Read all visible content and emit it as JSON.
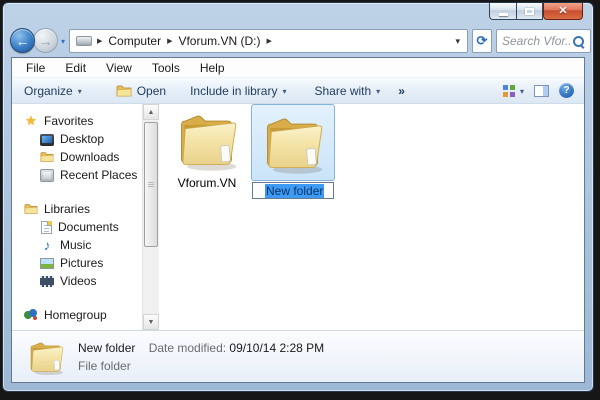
{
  "titlebar": {
    "close_icon": "✕"
  },
  "navbar": {
    "back_icon": "←",
    "forward_icon": "→",
    "history_dropdown_icon": "▾",
    "breadcrumb": {
      "separator": "▶",
      "items": [
        "Computer",
        "Vforum.VN (D:)"
      ]
    },
    "address_dropdown_icon": "▾",
    "refresh_icon": "⟳",
    "search": {
      "placeholder": "Search Vfor..."
    }
  },
  "menubar": {
    "items": [
      "File",
      "Edit",
      "View",
      "Tools",
      "Help"
    ]
  },
  "toolbar": {
    "organize_label": "Organize",
    "open_label": "Open",
    "include_label": "Include in library",
    "share_label": "Share with",
    "more_label": "»",
    "caret": "▾",
    "help_glyph": "?"
  },
  "sidebar": {
    "sections": [
      {
        "label": "Favorites",
        "children": [
          {
            "label": "Desktop"
          },
          {
            "label": "Downloads"
          },
          {
            "label": "Recent Places"
          }
        ]
      },
      {
        "label": "Libraries",
        "children": [
          {
            "label": "Documents"
          },
          {
            "label": "Music"
          },
          {
            "label": "Pictures"
          },
          {
            "label": "Videos"
          }
        ]
      },
      {
        "label": "Homegroup",
        "children": []
      }
    ],
    "star_glyph": "★",
    "music_glyph": "♪"
  },
  "scrollbar": {
    "up_icon": "▲",
    "down_icon": "▼"
  },
  "content": {
    "folders": [
      {
        "name": "Vforum.VN"
      },
      {
        "name": "New folder",
        "state": "renaming-selected"
      }
    ]
  },
  "details_pane": {
    "name": "New folder",
    "date_label": "Date modified:",
    "date_value": "09/10/14 2:28 PM",
    "type": "File folder"
  },
  "colors": {
    "selection_highlight": "#3d9bf5",
    "selection_tile_border": "#84b4e4",
    "close_button_red": "#c74c2e",
    "folder_yellow": "#e9d28b",
    "frame_blue": "#a9c2dc"
  }
}
